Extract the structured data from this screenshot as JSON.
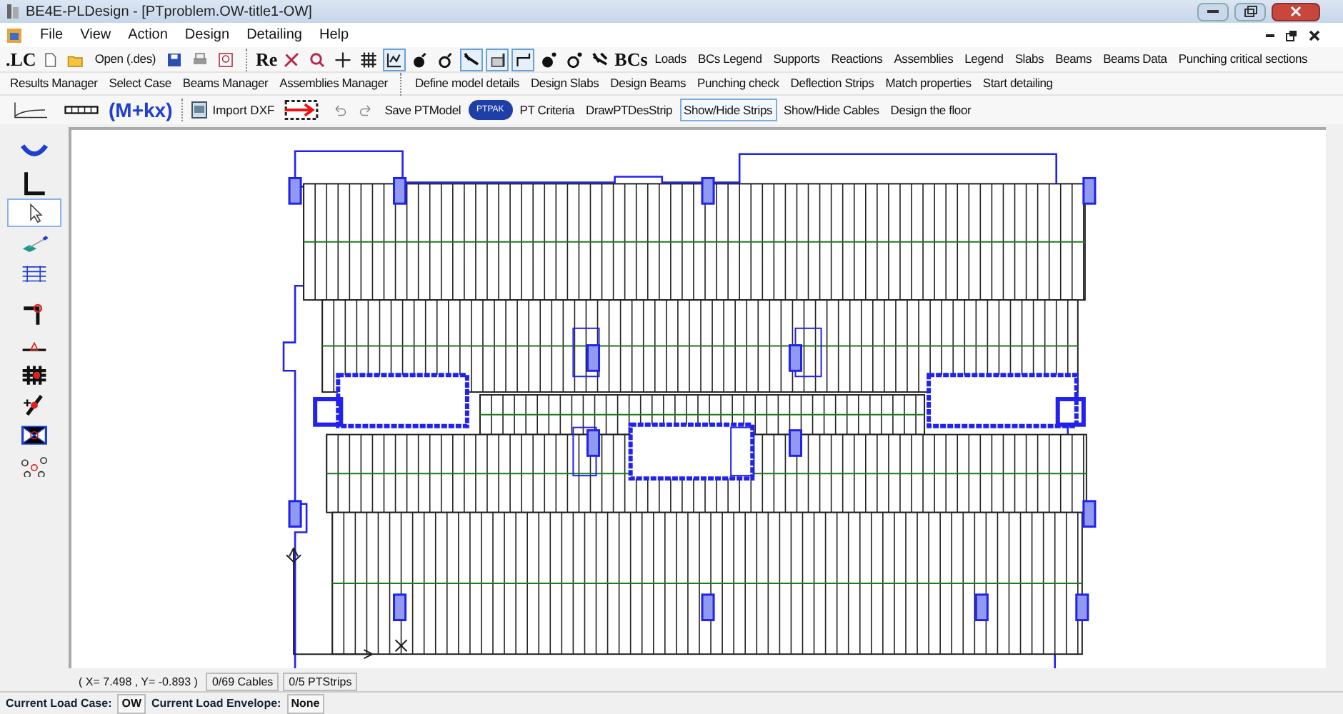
{
  "window": {
    "title": "BE4E-PLDesign - [PTproblem.OW-title1-OW]"
  },
  "menu": [
    "File",
    "View",
    "Action",
    "Design",
    "Detailing",
    "Help"
  ],
  "toolbar1": [
    {
      "kind": "big",
      "label": ".LC"
    },
    {
      "kind": "icon",
      "selected": false
    },
    {
      "kind": "icon",
      "selected": false
    },
    {
      "kind": "text",
      "label": "Open (.des)"
    },
    {
      "kind": "icon",
      "selected": false
    },
    {
      "kind": "icon",
      "selected": false
    },
    {
      "kind": "icon",
      "selected": false
    },
    {
      "kind": "sep"
    },
    {
      "kind": "big",
      "label": "Re"
    },
    {
      "kind": "icon",
      "selected": false
    },
    {
      "kind": "icon",
      "selected": false
    },
    {
      "kind": "icon",
      "selected": false
    },
    {
      "kind": "icon",
      "selected": false
    },
    {
      "kind": "icon",
      "selected": true
    },
    {
      "kind": "icon",
      "selected": false
    },
    {
      "kind": "icon",
      "selected": false
    },
    {
      "kind": "icon",
      "selected": true
    },
    {
      "kind": "icon",
      "selected": true
    },
    {
      "kind": "icon",
      "selected": true
    },
    {
      "kind": "icon",
      "selected": false
    },
    {
      "kind": "icon",
      "selected": false
    },
    {
      "kind": "icon",
      "selected": false
    },
    {
      "kind": "big",
      "label": "BCs"
    },
    {
      "kind": "text",
      "label": "Loads"
    },
    {
      "kind": "text",
      "label": "BCs Legend"
    },
    {
      "kind": "text",
      "label": "Supports"
    },
    {
      "kind": "text",
      "label": "Reactions"
    },
    {
      "kind": "text",
      "label": "Assemblies"
    },
    {
      "kind": "text",
      "label": "Legend"
    },
    {
      "kind": "text",
      "label": "Slabs"
    },
    {
      "kind": "text",
      "label": "Beams"
    },
    {
      "kind": "text",
      "label": "Beams Data"
    },
    {
      "kind": "text",
      "label": "Punching critical sections"
    }
  ],
  "toolbar2": [
    {
      "kind": "text",
      "label": "Results Manager"
    },
    {
      "kind": "text",
      "label": "Select Case"
    },
    {
      "kind": "text",
      "label": "Beams Manager"
    },
    {
      "kind": "text",
      "label": "Assemblies Manager"
    },
    {
      "kind": "sep"
    },
    {
      "kind": "text",
      "label": "Define model details"
    },
    {
      "kind": "text",
      "label": "Design Slabs"
    },
    {
      "kind": "text",
      "label": "Design Beams"
    },
    {
      "kind": "text",
      "label": "Punching check"
    },
    {
      "kind": "text",
      "label": "Deflection Strips"
    },
    {
      "kind": "text",
      "label": "Match properties"
    },
    {
      "kind": "text",
      "label": "Start detailing"
    }
  ],
  "toolbar3": [
    {
      "kind": "icon",
      "selected": false
    },
    {
      "kind": "icon",
      "selected": false
    },
    {
      "kind": "formula",
      "label": "(M+kx)"
    },
    {
      "kind": "sep"
    },
    {
      "kind": "icontext",
      "label": "Import DXF"
    },
    {
      "kind": "icon",
      "selected": false
    },
    {
      "kind": "icon",
      "selected": false
    },
    {
      "kind": "icon",
      "selected": false
    },
    {
      "kind": "text",
      "label": "Save PTModel",
      "selected": false
    },
    {
      "kind": "badge",
      "label": "PTPAK"
    },
    {
      "kind": "text",
      "label": "PT Criteria",
      "selected": false
    },
    {
      "kind": "text",
      "label": "DrawPTDesStrip",
      "selected": false
    },
    {
      "kind": "text",
      "label": "Show/Hide Strips",
      "selected": true
    },
    {
      "kind": "text",
      "label": "Show/Hide Cables",
      "selected": false
    },
    {
      "kind": "text",
      "label": "Design the floor",
      "selected": false
    }
  ],
  "toolbox": [
    {
      "selected": false
    },
    {
      "selected": false
    },
    {
      "selected": true
    },
    {
      "selected": false
    },
    {
      "selected": false
    },
    {
      "selected": false
    },
    {
      "selected": false
    },
    {
      "selected": false
    },
    {
      "selected": false
    },
    {
      "selected": false
    },
    {
      "selected": false
    }
  ],
  "status_bar": [
    "( X= 7.498 , Y= -0.893 )",
    "0/69 Cables",
    "0/5 PTStrips"
  ],
  "load_bar": [
    {
      "label": "Current Load Case:",
      "value": "OW"
    },
    {
      "label": "Current Load Envelope:",
      "value": "None"
    }
  ]
}
